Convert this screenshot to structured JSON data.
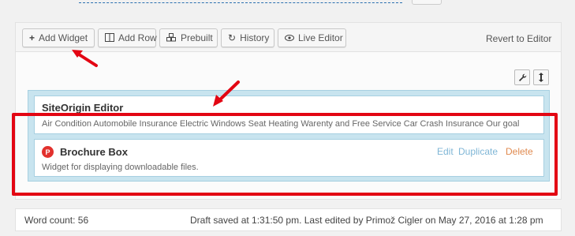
{
  "toolbar": {
    "add_widget": "Add Widget",
    "add_row": "Add Row",
    "prebuilt": "Prebuilt",
    "history": "History",
    "live_editor": "Live Editor",
    "revert": "Revert to Editor"
  },
  "row_controls": {
    "icons": [
      "wrench-icon",
      "move-vertical-icon"
    ]
  },
  "widgets": [
    {
      "title": "SiteOrigin Editor",
      "description": "Air Condition Automobile Insurance Electric Windows Seat Heating Warenty and Free Service Car Crash Insurance Our goal"
    },
    {
      "title": "Brochure Box",
      "description": "Widget for displaying downloadable files.",
      "icon": "brochure-icon",
      "actions": {
        "edit": "Edit",
        "duplicate": "Duplicate",
        "delete": "Delete"
      }
    }
  ],
  "status": {
    "word_count": "Word count: 56",
    "draft": "Draft saved at 1:31:50 pm. Last edited by Primož Cigler on May 27, 2016 at 1:28 pm"
  },
  "colors": {
    "annotation_red": "#e30613",
    "row_blue": "#c8e4ef",
    "link_blue": "#7fb6d6",
    "delete_orange": "#e08a4f",
    "brochure_red": "#e2312d"
  }
}
